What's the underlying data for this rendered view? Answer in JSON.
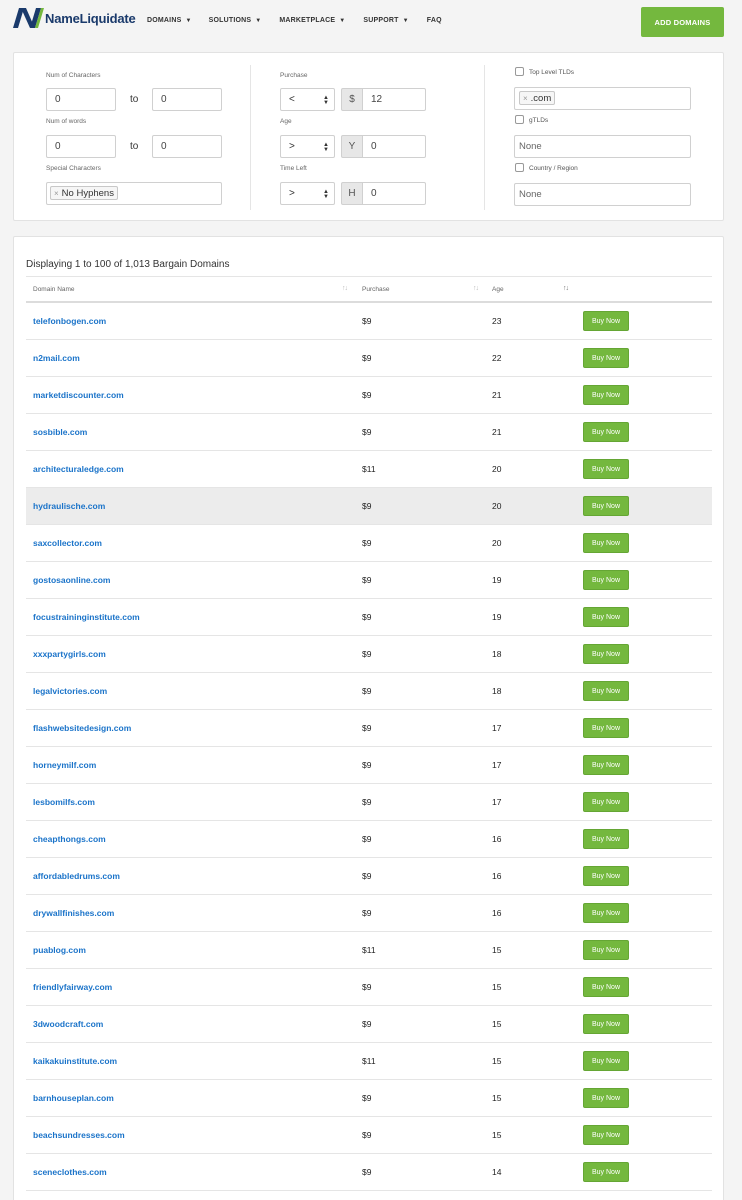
{
  "header": {
    "logo_text": "NameLiquidate",
    "nav": [
      {
        "label": "DOMAINS",
        "caret": true
      },
      {
        "label": "SOLUTIONS",
        "caret": true
      },
      {
        "label": "MARKETPLACE",
        "caret": true
      },
      {
        "label": "SUPPORT",
        "caret": true
      },
      {
        "label": "FAQ",
        "caret": false
      }
    ],
    "add_button": "ADD DOMAINS"
  },
  "filters": {
    "num_chars": {
      "label": "Num of Characters",
      "from": "0",
      "to_label": "to",
      "to": "0"
    },
    "num_words": {
      "label": "Num of words",
      "from": "0",
      "to_label": "to",
      "to": "0"
    },
    "special_chars": {
      "label": "Special Characters",
      "tag": "No Hyphens"
    },
    "purchase": {
      "label": "Purchase",
      "operator": "<",
      "addon": "$",
      "value": "12"
    },
    "age": {
      "label": "Age",
      "operator": ">",
      "addon": "Y",
      "value": "0"
    },
    "time_left": {
      "label": "Time Left",
      "operator": ">",
      "addon": "H",
      "value": "0"
    },
    "top_level_tlds": {
      "label": "Top Level TLDs",
      "tag": ".com"
    },
    "gtlds": {
      "label": "gTLDs",
      "placeholder": "None"
    },
    "country": {
      "label": "Country / Region",
      "placeholder": "None"
    }
  },
  "results": {
    "count_text": "Displaying 1 to 100 of 1,013 Bargain Domains",
    "columns": [
      "Domain Name",
      "Purchase",
      "Age"
    ],
    "buy_label": "Buy Now",
    "rows": [
      {
        "domain": "telefonbogen.com",
        "price": "$9",
        "age": "23"
      },
      {
        "domain": "n2mail.com",
        "price": "$9",
        "age": "22"
      },
      {
        "domain": "marketdiscounter.com",
        "price": "$9",
        "age": "21"
      },
      {
        "domain": "sosbible.com",
        "price": "$9",
        "age": "21"
      },
      {
        "domain": "architecturaledge.com",
        "price": "$11",
        "age": "20"
      },
      {
        "domain": "hydraulische.com",
        "price": "$9",
        "age": "20"
      },
      {
        "domain": "saxcollector.com",
        "price": "$9",
        "age": "20"
      },
      {
        "domain": "gostosaonline.com",
        "price": "$9",
        "age": "19"
      },
      {
        "domain": "focustraininginstitute.com",
        "price": "$9",
        "age": "19"
      },
      {
        "domain": "xxxpartygirls.com",
        "price": "$9",
        "age": "18"
      },
      {
        "domain": "legalvictories.com",
        "price": "$9",
        "age": "18"
      },
      {
        "domain": "flashwebsitedesign.com",
        "price": "$9",
        "age": "17"
      },
      {
        "domain": "horneymilf.com",
        "price": "$9",
        "age": "17"
      },
      {
        "domain": "lesbomilfs.com",
        "price": "$9",
        "age": "17"
      },
      {
        "domain": "cheapthongs.com",
        "price": "$9",
        "age": "16"
      },
      {
        "domain": "affordabledrums.com",
        "price": "$9",
        "age": "16"
      },
      {
        "domain": "drywallfinishes.com",
        "price": "$9",
        "age": "16"
      },
      {
        "domain": "puablog.com",
        "price": "$11",
        "age": "15"
      },
      {
        "domain": "friendlyfairway.com",
        "price": "$9",
        "age": "15"
      },
      {
        "domain": "3dwoodcraft.com",
        "price": "$9",
        "age": "15"
      },
      {
        "domain": "kaikakuinstitute.com",
        "price": "$11",
        "age": "15"
      },
      {
        "domain": "barnhouseplan.com",
        "price": "$9",
        "age": "15"
      },
      {
        "domain": "beachsundresses.com",
        "price": "$9",
        "age": "15"
      },
      {
        "domain": "sceneclothes.com",
        "price": "$9",
        "age": "14"
      }
    ],
    "highlighted_index": 5
  },
  "colors": {
    "accent_green": "#74b83e",
    "link_blue": "#1a73c9",
    "logo_navy": "#1a3a6b"
  }
}
